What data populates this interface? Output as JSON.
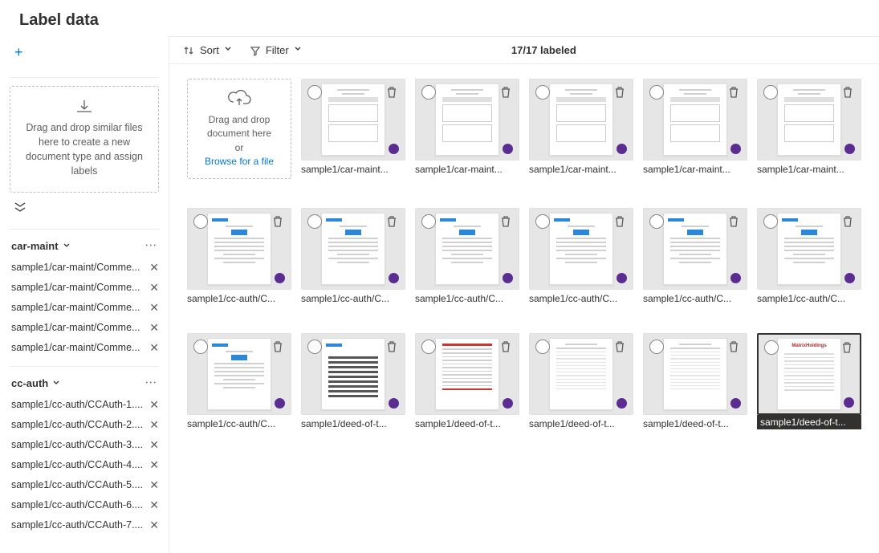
{
  "page": {
    "title": "Label data"
  },
  "sidebar": {
    "add_label": "+",
    "dropzone_text": "Drag and drop similar files here to create a new document type and assign labels",
    "groups": [
      {
        "name": "car-maint",
        "files": [
          "sample1/car-maint/Comme...",
          "sample1/car-maint/Comme...",
          "sample1/car-maint/Comme...",
          "sample1/car-maint/Comme...",
          "sample1/car-maint/Comme..."
        ]
      },
      {
        "name": "cc-auth",
        "files": [
          "sample1/cc-auth/CCAuth-1....",
          "sample1/cc-auth/CCAuth-2....",
          "sample1/cc-auth/CCAuth-3....",
          "sample1/cc-auth/CCAuth-4....",
          "sample1/cc-auth/CCAuth-5....",
          "sample1/cc-auth/CCAuth-6....",
          "sample1/cc-auth/CCAuth-7...."
        ]
      }
    ]
  },
  "toolbar": {
    "sort_label": "Sort",
    "filter_label": "Filter",
    "status": "17/17 labeled"
  },
  "dropzone_main": {
    "line1": "Drag and drop",
    "line2": "document here",
    "line3": "or",
    "link": "Browse for a file"
  },
  "tiles": [
    {
      "label": "sample1/car-maint...",
      "type": "a",
      "selected": false
    },
    {
      "label": "sample1/car-maint...",
      "type": "a",
      "selected": false
    },
    {
      "label": "sample1/car-maint...",
      "type": "a",
      "selected": false
    },
    {
      "label": "sample1/car-maint...",
      "type": "a",
      "selected": false
    },
    {
      "label": "sample1/car-maint...",
      "type": "a",
      "selected": false
    },
    {
      "label": "sample1/cc-auth/C...",
      "type": "b",
      "selected": false
    },
    {
      "label": "sample1/cc-auth/C...",
      "type": "b",
      "selected": false
    },
    {
      "label": "sample1/cc-auth/C...",
      "type": "b",
      "selected": false
    },
    {
      "label": "sample1/cc-auth/C...",
      "type": "b",
      "selected": false
    },
    {
      "label": "sample1/cc-auth/C...",
      "type": "b",
      "selected": false
    },
    {
      "label": "sample1/cc-auth/C...",
      "type": "b",
      "selected": false
    },
    {
      "label": "sample1/cc-auth/C...",
      "type": "b",
      "selected": false
    },
    {
      "label": "sample1/deed-of-t...",
      "type": "c",
      "selected": false
    },
    {
      "label": "sample1/deed-of-t...",
      "type": "d",
      "selected": false
    },
    {
      "label": "sample1/deed-of-t...",
      "type": "e",
      "selected": false
    },
    {
      "label": "sample1/deed-of-t...",
      "type": "e",
      "selected": false
    },
    {
      "label": "sample1/deed-of-t...",
      "type": "f",
      "selected": true
    }
  ]
}
